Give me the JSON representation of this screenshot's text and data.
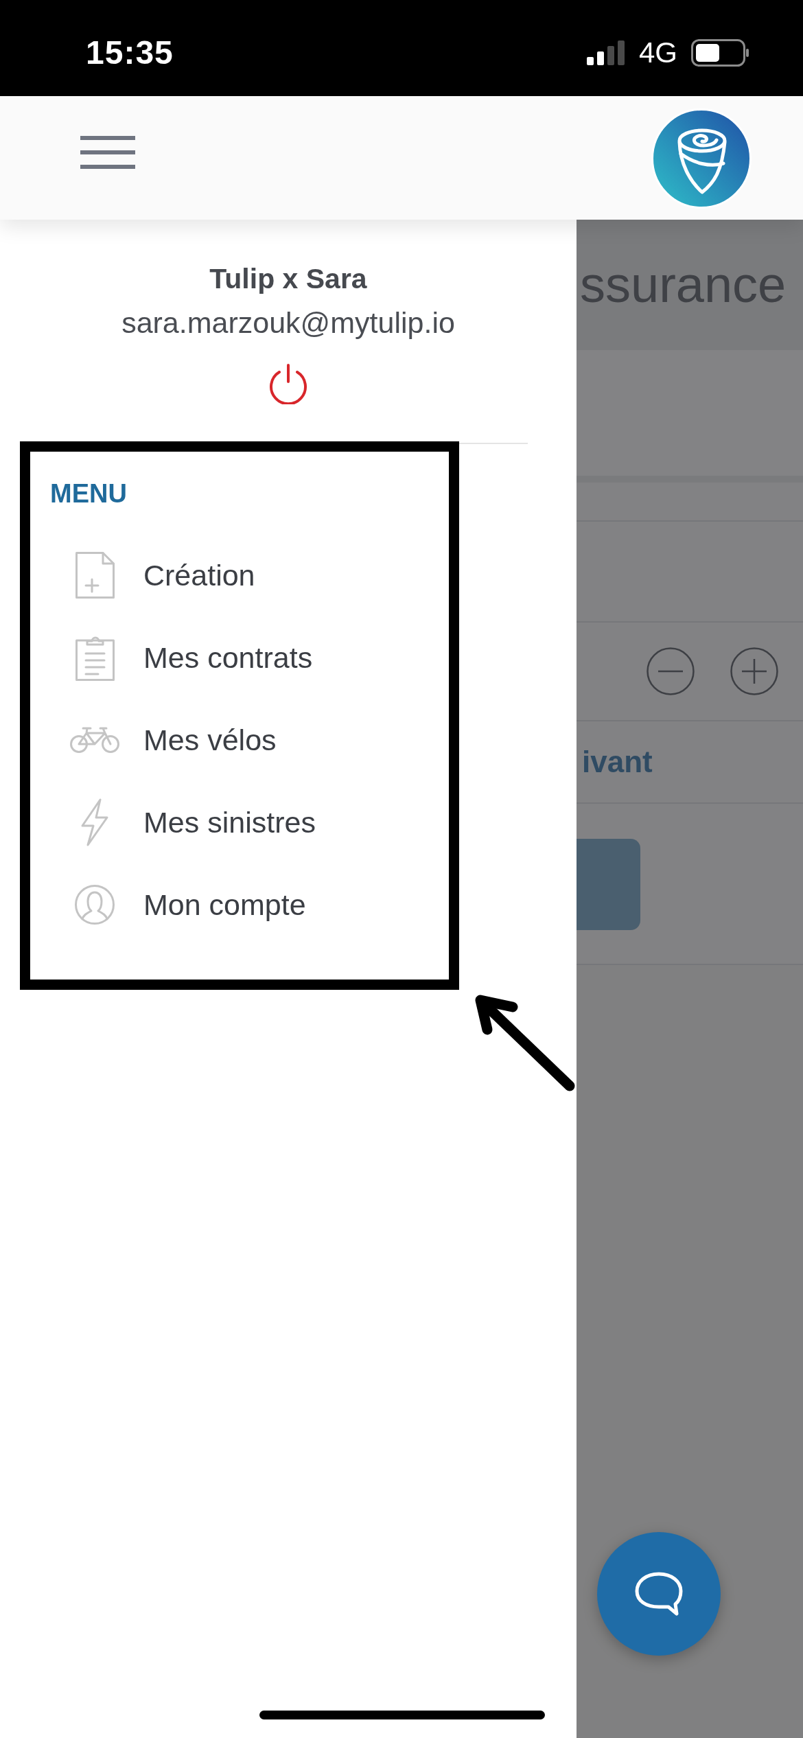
{
  "status_bar": {
    "time": "15:35",
    "network": "4G"
  },
  "drawer": {
    "user_name": "Tulip x Sara",
    "email": "sara.marzouk@mytulip.io",
    "menu_title": "MENU",
    "menu_items": [
      {
        "label": "Création"
      },
      {
        "label": "Mes contrats"
      },
      {
        "label": "Mes vélos"
      },
      {
        "label": "Mes sinistres"
      },
      {
        "label": "Mon compte"
      }
    ]
  },
  "background_page": {
    "title": "ssurance",
    "row_label": "ivant"
  }
}
